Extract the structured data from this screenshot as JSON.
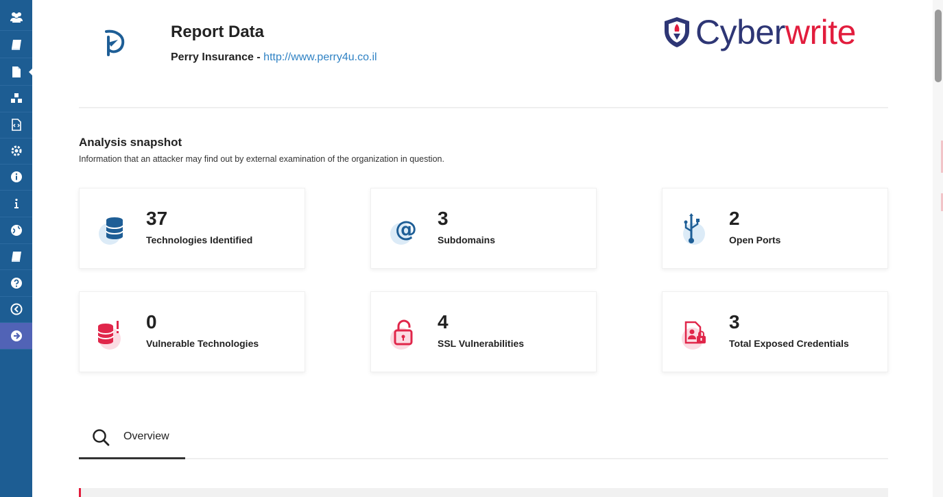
{
  "sidebar": {
    "items": [
      {
        "icon": "users-icon"
      },
      {
        "icon": "book-icon"
      },
      {
        "icon": "document-icon",
        "active": true
      },
      {
        "icon": "cubes-icon"
      },
      {
        "icon": "code-file-icon"
      },
      {
        "icon": "gear-icon"
      },
      {
        "icon": "info-circle-icon"
      },
      {
        "icon": "info-icon"
      },
      {
        "icon": "globe-icon"
      },
      {
        "icon": "book-icon"
      },
      {
        "icon": "question-icon"
      },
      {
        "icon": "back-arrow-icon"
      },
      {
        "icon": "next-arrow-icon"
      }
    ]
  },
  "header": {
    "title": "Report Data",
    "company": "Perry Insurance",
    "separator": " - ",
    "url": "http://www.perry4u.co.il",
    "brand_part1": "Cyber",
    "brand_part2": "write"
  },
  "snapshot": {
    "title": "Analysis snapshot",
    "description": "Information that an attacker may find out by external examination of the organization in question.",
    "cards": [
      {
        "value": "37",
        "label": "Technologies Identified",
        "icon": "database-icon"
      },
      {
        "value": "3",
        "label": "Subdomains",
        "icon": "at-sign-icon"
      },
      {
        "value": "2",
        "label": "Open Ports",
        "icon": "usb-icon"
      },
      {
        "value": "0",
        "label": "Vulnerable Technologies",
        "icon": "database-alert-icon"
      },
      {
        "value": "4",
        "label": "SSL Vulnerabilities",
        "icon": "unlocked-padlock-icon"
      },
      {
        "value": "3",
        "label": "Total Exposed Credentials",
        "icon": "locked-file-icon"
      }
    ]
  },
  "tabs": [
    {
      "label": "Overview",
      "icon": "search-icon",
      "active": true
    }
  ],
  "colors": {
    "sidebar": "#1d5d93",
    "accent_blue": "#2f82c4",
    "brand_navy": "#2e3675",
    "brand_red": "#e21d3d",
    "icon_blue": "#1e5e96",
    "icon_red": "#e0264a"
  }
}
